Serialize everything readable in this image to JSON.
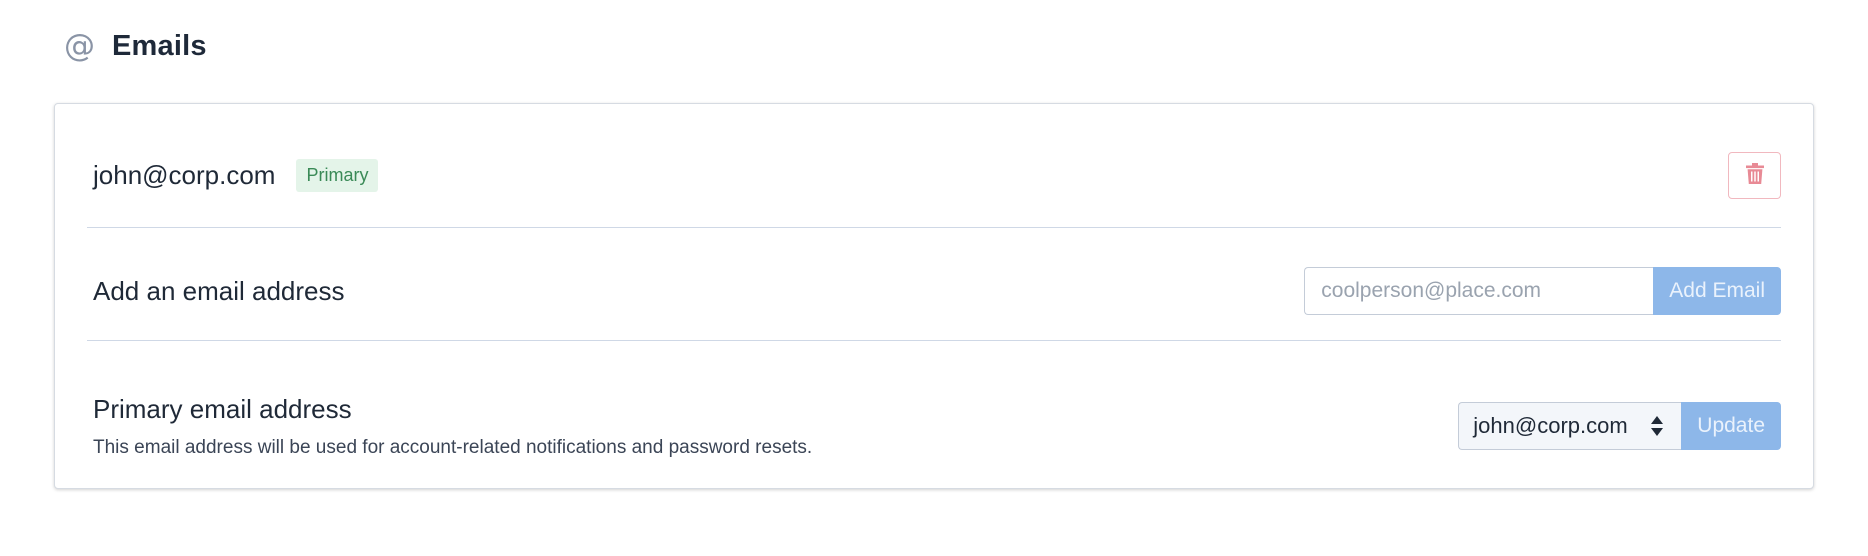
{
  "header": {
    "icon": "at-icon",
    "title": "Emails"
  },
  "emails": [
    {
      "address": "john@corp.com",
      "badge": "Primary",
      "delete_icon": "trash-icon"
    }
  ],
  "add_email": {
    "label": "Add an email address",
    "placeholder": "coolperson@place.com",
    "value": "",
    "button_label": "Add Email"
  },
  "primary_email": {
    "title": "Primary email address",
    "description": "This email address will be used for account-related notifications and password resets.",
    "selected": "john@corp.com",
    "button_label": "Update"
  },
  "colors": {
    "badge_bg": "#e4f4e9",
    "badge_text": "#3a8a57",
    "button_blue": "#8db7e9",
    "delete_red": "#e88a95"
  }
}
